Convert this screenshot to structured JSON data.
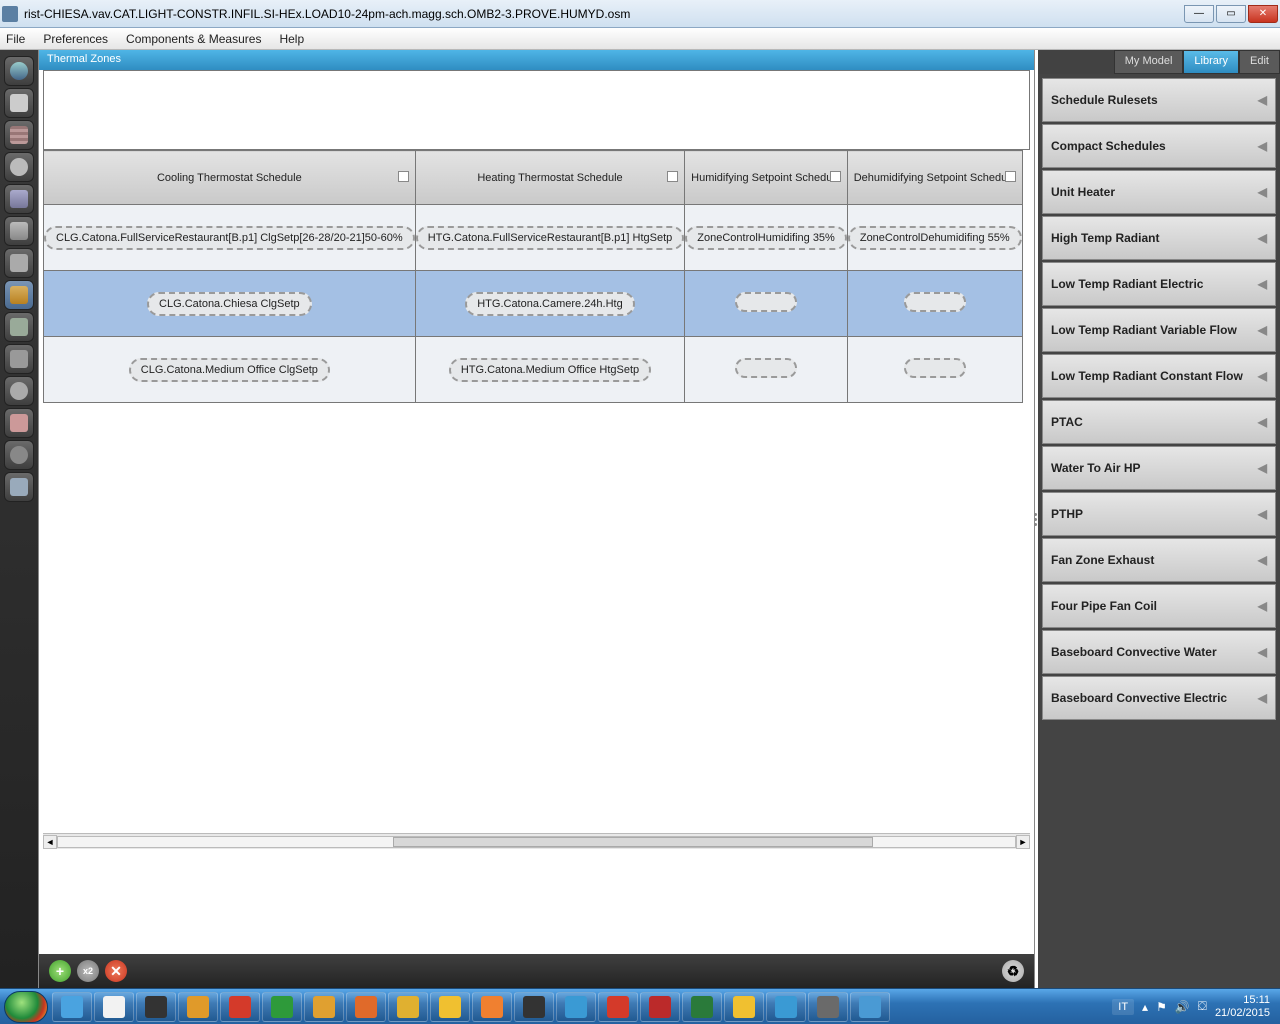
{
  "window": {
    "title": "rist-CHIESA.vav.CAT.LIGHT-CONSTR.INFIL.SI-HEx.LOAD10-24pm-ach.magg.sch.OMB2-3.PROVE.HUMYD.osm"
  },
  "menu": [
    "File",
    "Preferences",
    "Components & Measures",
    "Help"
  ],
  "panel_title": "Thermal Zones",
  "columns": [
    "Cooling Thermostat Schedule",
    "Heating Thermostat Schedule",
    "Humidifying Setpoint Schedule",
    "Dehumidifying Setpoint Schedule"
  ],
  "rows": [
    {
      "selected": false,
      "cells": [
        "CLG.Catona.FullServiceRestaurant[B.p1]  ClgSetp[26-28/20-21]50-60%",
        "HTG.Catona.FullServiceRestaurant[B.p1] HtgSetp",
        "ZoneControlHumidifing 35%",
        "ZoneControlDehumidifing 55%"
      ]
    },
    {
      "selected": true,
      "cells": [
        "CLG.Catona.Chiesa ClgSetp",
        "HTG.Catona.Camere.24h.Htg",
        "",
        ""
      ]
    },
    {
      "selected": false,
      "cells": [
        "CLG.Catona.Medium Office ClgSetp",
        "HTG.Catona.Medium Office HtgSetp",
        "",
        ""
      ]
    }
  ],
  "right_tabs": [
    "My Model",
    "Library",
    "Edit"
  ],
  "right_tab_active": 1,
  "library": [
    "Schedule Rulesets",
    "Compact Schedules",
    "Unit Heater",
    "High Temp Radiant",
    "Low Temp Radiant Electric",
    "Low Temp Radiant Variable Flow",
    "Low Temp Radiant Constant Flow",
    "PTAC",
    "Water To Air HP",
    "PTHP",
    "Fan Zone Exhaust",
    "Four Pipe Fan Coil",
    "Baseboard Convective Water",
    "Baseboard Convective Electric"
  ],
  "taskbar_icon_colors": [
    "#4aa3e0",
    "#f2f2f2",
    "#333",
    "#e09a2a",
    "#d43a2a",
    "#2e9a3a",
    "#e0a030",
    "#e06a2a",
    "#e0b030",
    "#f0c030",
    "#f08030",
    "#333",
    "#3a9ad4",
    "#d43a2a",
    "#bb2a2a",
    "#2a7a3a",
    "#f0c030",
    "#3a9ad4",
    "#6a6a6a",
    "#4a9ad4"
  ],
  "tray": {
    "lang": "IT",
    "time": "15:11",
    "date": "21/02/2015"
  }
}
